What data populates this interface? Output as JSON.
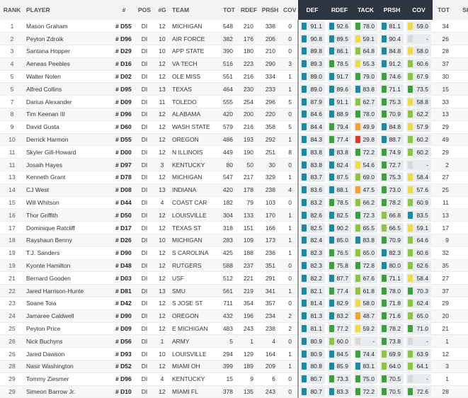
{
  "headers": {
    "rank": "RANK",
    "player": "PLAYER",
    "num": "#",
    "pos": "POS",
    "games": "#G",
    "team": "TEAM",
    "tot": "TOT",
    "rdef": "RDEF",
    "prsh": "PRSH",
    "cov": "COV",
    "g_def": "DEF",
    "g_rdef": "RDEF",
    "g_tack": "TACK",
    "g_prsh": "PRSH",
    "g_cov": "COV",
    "tot2": "TOT",
    "sk": "SK"
  },
  "grade_colors": {
    "elite": "#1a8aa0",
    "high": "#3aa23a",
    "good": "#8cc63f",
    "avg": "#f0dc3c",
    "below": "#f3a12b",
    "poor": "#e0392b"
  },
  "rows": [
    {
      "rank": "1",
      "player": "Mason Graham",
      "num": "# D55",
      "pos": "DI",
      "g": "12",
      "team": "MICHIGAN",
      "tot": "548",
      "rdef": "210",
      "prsh": "338",
      "cov": "0",
      "def": "91.1",
      "grdef": "92.6",
      "tack": "78.0",
      "gprsh": "81.1",
      "gcov": "59.0",
      "tot2": "34",
      "sk": "5"
    },
    {
      "rank": "2",
      "player": "Peyton Zdroik",
      "num": "# D96",
      "pos": "DI",
      "g": "10",
      "team": "AIR FORCE",
      "tot": "382",
      "rdef": "176",
      "prsh": "206",
      "cov": "0",
      "def": "90.8",
      "grdef": "89.5",
      "tack": "59.1",
      "gprsh": "90.4",
      "gcov": "-",
      "tot2": "26",
      "sk": "2"
    },
    {
      "rank": "3",
      "player": "Santana Hopper",
      "num": "# D29",
      "pos": "DI",
      "g": "10",
      "team": "APP STATE",
      "tot": "390",
      "rdef": "180",
      "prsh": "210",
      "cov": "0",
      "def": "89.8",
      "grdef": "86.1",
      "tack": "64.8",
      "gprsh": "84.8",
      "gcov": "58.0",
      "tot2": "28",
      "sk": "7"
    },
    {
      "rank": "4",
      "player": "Aeneas Peebles",
      "num": "# D16",
      "pos": "DI",
      "g": "12",
      "team": "VA TECH",
      "tot": "516",
      "rdef": "223",
      "prsh": "290",
      "cov": "3",
      "def": "89.3",
      "grdef": "78.5",
      "tack": "55.3",
      "gprsh": "91.2",
      "gcov": "60.6",
      "tot2": "37",
      "sk": "3"
    },
    {
      "rank": "5",
      "player": "Walter Nolen",
      "num": "# D02",
      "pos": "DI",
      "g": "12",
      "team": "OLE MISS",
      "tot": "551",
      "rdef": "216",
      "prsh": "334",
      "cov": "1",
      "def": "89.0",
      "grdef": "91.7",
      "tack": "79.0",
      "gprsh": "74.6",
      "gcov": "67.9",
      "tot2": "30",
      "sk": "6"
    },
    {
      "rank": "5",
      "player": "Alfred Collins",
      "num": "# D95",
      "pos": "DI",
      "g": "13",
      "team": "TEXAS",
      "tot": "464",
      "rdef": "230",
      "prsh": "233",
      "cov": "1",
      "def": "89.0",
      "grdef": "89.6",
      "tack": "83.8",
      "gprsh": "71.1",
      "gcov": "73.5",
      "tot2": "15",
      "sk": "1"
    },
    {
      "rank": "7",
      "player": "Darius Alexander",
      "num": "# D09",
      "pos": "DI",
      "g": "11",
      "team": "TOLEDO",
      "tot": "555",
      "rdef": "254",
      "prsh": "296",
      "cov": "5",
      "def": "87.9",
      "grdef": "91.1",
      "tack": "62.7",
      "gprsh": "75.3",
      "gcov": "58.8",
      "tot2": "33",
      "sk": "3"
    },
    {
      "rank": "8",
      "player": "Tim Keenan III",
      "num": "# D96",
      "pos": "DI",
      "g": "12",
      "team": "ALABAMA",
      "tot": "420",
      "rdef": "200",
      "prsh": "220",
      "cov": "0",
      "def": "84.6",
      "grdef": "88.9",
      "tack": "78.0",
      "gprsh": "70.9",
      "gcov": "62.2",
      "tot2": "13",
      "sk": "0"
    },
    {
      "rank": "9",
      "player": "David Gusta",
      "num": "# D60",
      "pos": "DI",
      "g": "12",
      "team": "WASH STATE",
      "tot": "579",
      "rdef": "216",
      "prsh": "358",
      "cov": "5",
      "def": "84.4",
      "grdef": "79.4",
      "tack": "49.9",
      "gprsh": "84.8",
      "gcov": "57.9",
      "tot2": "29",
      "sk": "1"
    },
    {
      "rank": "10",
      "player": "Derrick Harmon",
      "num": "# D55",
      "pos": "DI",
      "g": "12",
      "team": "OREGON",
      "tot": "486",
      "rdef": "193",
      "prsh": "292",
      "cov": "1",
      "def": "84.3",
      "grdef": "77.4",
      "tack": "29.8",
      "gprsh": "88.7",
      "gcov": "60.2",
      "tot2": "49",
      "sk": "4"
    },
    {
      "rank": "11",
      "player": "Skyler Gill-Howard",
      "num": "# D00",
      "pos": "DI",
      "g": "12",
      "team": "N ILLINOIS",
      "tot": "449",
      "rdef": "190",
      "prsh": "251",
      "cov": "8",
      "def": "83.8",
      "grdef": "83.8",
      "tack": "72.2",
      "gprsh": "74.9",
      "gcov": "60.2",
      "tot2": "29",
      "sk": "5"
    },
    {
      "rank": "11",
      "player": "Josaih Hayes",
      "num": "# D97",
      "pos": "DI",
      "g": "3",
      "team": "KENTUCKY",
      "tot": "80",
      "rdef": "50",
      "prsh": "30",
      "cov": "0",
      "def": "83.8",
      "grdef": "82.4",
      "tack": "54.6",
      "gprsh": "72.7",
      "gcov": "-",
      "tot2": "2",
      "sk": "0"
    },
    {
      "rank": "13",
      "player": "Kenneth Grant",
      "num": "# D78",
      "pos": "DI",
      "g": "12",
      "team": "MICHIGAN",
      "tot": "547",
      "rdef": "217",
      "prsh": "329",
      "cov": "1",
      "def": "83.7",
      "grdef": "87.5",
      "tack": "69.0",
      "gprsh": "75.3",
      "gcov": "58.4",
      "tot2": "27",
      "sk": "3"
    },
    {
      "rank": "14",
      "player": "CJ West",
      "num": "# D08",
      "pos": "DI",
      "g": "13",
      "team": "INDIANA",
      "tot": "420",
      "rdef": "178",
      "prsh": "238",
      "cov": "4",
      "def": "83.6",
      "grdef": "88.1",
      "tack": "47.5",
      "gprsh": "73.0",
      "gcov": "57.6",
      "tot2": "25",
      "sk": "1"
    },
    {
      "rank": "15",
      "player": "Will Whitson",
      "num": "# D44",
      "pos": "DI",
      "g": "4",
      "team": "COAST CAR",
      "tot": "182",
      "rdef": "79",
      "prsh": "103",
      "cov": "0",
      "def": "83.2",
      "grdef": "78.5",
      "tack": "66.2",
      "gprsh": "78.2",
      "gcov": "60.9",
      "tot2": "11",
      "sk": "2"
    },
    {
      "rank": "16",
      "player": "Thor Griffith",
      "num": "# D50",
      "pos": "DI",
      "g": "12",
      "team": "LOUISVILLE",
      "tot": "304",
      "rdef": "133",
      "prsh": "170",
      "cov": "1",
      "def": "82.6",
      "grdef": "82.5",
      "tack": "72.3",
      "gprsh": "66.8",
      "gcov": "83.5",
      "tot2": "13",
      "sk": "2"
    },
    {
      "rank": "17",
      "player": "Dominique Ratcliff",
      "num": "# D17",
      "pos": "DI",
      "g": "12",
      "team": "TEXAS ST",
      "tot": "318",
      "rdef": "151",
      "prsh": "166",
      "cov": "1",
      "def": "82.5",
      "grdef": "90.2",
      "tack": "65.5",
      "gprsh": "66.5",
      "gcov": "59.1",
      "tot2": "17",
      "sk": "2"
    },
    {
      "rank": "18",
      "player": "Rayshaun Benny",
      "num": "# D26",
      "pos": "DI",
      "g": "10",
      "team": "MICHIGAN",
      "tot": "283",
      "rdef": "109",
      "prsh": "173",
      "cov": "1",
      "def": "82.4",
      "grdef": "85.0",
      "tack": "83.8",
      "gprsh": "70.9",
      "gcov": "64.6",
      "tot2": "9",
      "sk": "0"
    },
    {
      "rank": "19",
      "player": "T.J. Sanders",
      "num": "# D90",
      "pos": "DI",
      "g": "12",
      "team": "S CAROLINA",
      "tot": "425",
      "rdef": "188",
      "prsh": "236",
      "cov": "1",
      "def": "82.3",
      "grdef": "76.5",
      "tack": "65.0",
      "gprsh": "82.3",
      "gcov": "60.6",
      "tot2": "32",
      "sk": "5"
    },
    {
      "rank": "19",
      "player": "Kyonte Hamilton",
      "num": "# D48",
      "pos": "DI",
      "g": "12",
      "team": "RUTGERS",
      "tot": "588",
      "rdef": "237",
      "prsh": "351",
      "cov": "0",
      "def": "82.3",
      "grdef": "75.8",
      "tack": "72.8",
      "gprsh": "80.0",
      "gcov": "62.6",
      "tot2": "35",
      "sk": "4"
    },
    {
      "rank": "21",
      "player": "Bernard Gooden",
      "num": "# D03",
      "pos": "DI",
      "g": "12",
      "team": "USF",
      "tot": "512",
      "rdef": "221",
      "prsh": "291",
      "cov": "0",
      "def": "82.2",
      "grdef": "87.7",
      "tack": "67.6",
      "gprsh": "71.1",
      "gcov": "58.4",
      "tot2": "27",
      "sk": "2"
    },
    {
      "rank": "22",
      "player": "Jared Harrison-Hunte",
      "num": "# D81",
      "pos": "DI",
      "g": "13",
      "team": "SMU",
      "tot": "561",
      "rdef": "219",
      "prsh": "341",
      "cov": "1",
      "def": "82.1",
      "grdef": "77.4",
      "tack": "61.8",
      "gprsh": "78.0",
      "gcov": "70.3",
      "tot2": "37",
      "sk": "6"
    },
    {
      "rank": "23",
      "player": "Soane Toia",
      "num": "# D42",
      "pos": "DI",
      "g": "12",
      "team": "S JOSE ST",
      "tot": "711",
      "rdef": "354",
      "prsh": "357",
      "cov": "0",
      "def": "81.4",
      "grdef": "82.9",
      "tack": "58.0",
      "gprsh": "71.8",
      "gcov": "62.4",
      "tot2": "29",
      "sk": "5"
    },
    {
      "rank": "24",
      "player": "Jamaree Caldwell",
      "num": "# D90",
      "pos": "DI",
      "g": "12",
      "team": "OREGON",
      "tot": "432",
      "rdef": "196",
      "prsh": "234",
      "cov": "2",
      "def": "81.3",
      "grdef": "83.2",
      "tack": "48.7",
      "gprsh": "71.6",
      "gcov": "65.0",
      "tot2": "20",
      "sk": "1"
    },
    {
      "rank": "25",
      "player": "Peyton Price",
      "num": "# D09",
      "pos": "DI",
      "g": "12",
      "team": "E MICHIGAN",
      "tot": "483",
      "rdef": "243",
      "prsh": "238",
      "cov": "2",
      "def": "81.1",
      "grdef": "77.2",
      "tack": "59.2",
      "gprsh": "78.2",
      "gcov": "71.0",
      "tot2": "21",
      "sk": "4"
    },
    {
      "rank": "26",
      "player": "Nick Buchyns",
      "num": "# D56",
      "pos": "DI",
      "g": "1",
      "team": "ARMY",
      "tot": "5",
      "rdef": "1",
      "prsh": "4",
      "cov": "0",
      "def": "80.9",
      "grdef": "60.0",
      "tack": "-",
      "gprsh": "73.8",
      "gcov": "-",
      "tot2": "1",
      "sk": "0"
    },
    {
      "rank": "26",
      "player": "Jared Dawson",
      "num": "# D93",
      "pos": "DI",
      "g": "10",
      "team": "LOUISVILLE",
      "tot": "294",
      "rdef": "129",
      "prsh": "164",
      "cov": "1",
      "def": "80.9",
      "grdef": "84.5",
      "tack": "74.4",
      "gprsh": "69.9",
      "gcov": "63.9",
      "tot2": "12",
      "sk": "5"
    },
    {
      "rank": "28",
      "player": "Nasir Washington",
      "num": "# D52",
      "pos": "DI",
      "g": "12",
      "team": "MIAMI OH",
      "tot": "399",
      "rdef": "189",
      "prsh": "209",
      "cov": "1",
      "def": "80.8",
      "grdef": "85.9",
      "tack": "83.1",
      "gprsh": "64.0",
      "gcov": "64.1",
      "tot2": "3",
      "sk": "0"
    },
    {
      "rank": "29",
      "player": "Tommy Ziesmer",
      "num": "# D96",
      "pos": "DI",
      "g": "4",
      "team": "KENTUCKY",
      "tot": "15",
      "rdef": "9",
      "prsh": "6",
      "cov": "0",
      "def": "80.7",
      "grdef": "73.3",
      "tack": "75.0",
      "gprsh": "70.5",
      "gcov": "-",
      "tot2": "1",
      "sk": "0"
    },
    {
      "rank": "29",
      "player": "Simeon Barrow Jr.",
      "num": "# D10",
      "pos": "DI",
      "g": "12",
      "team": "MIAMI FL",
      "tot": "378",
      "rdef": "135",
      "prsh": "243",
      "cov": "0",
      "def": "80.7",
      "grdef": "83.3",
      "tack": "72.2",
      "gprsh": "70.5",
      "gcov": "72.6",
      "tot2": "28",
      "sk": "7"
    }
  ]
}
